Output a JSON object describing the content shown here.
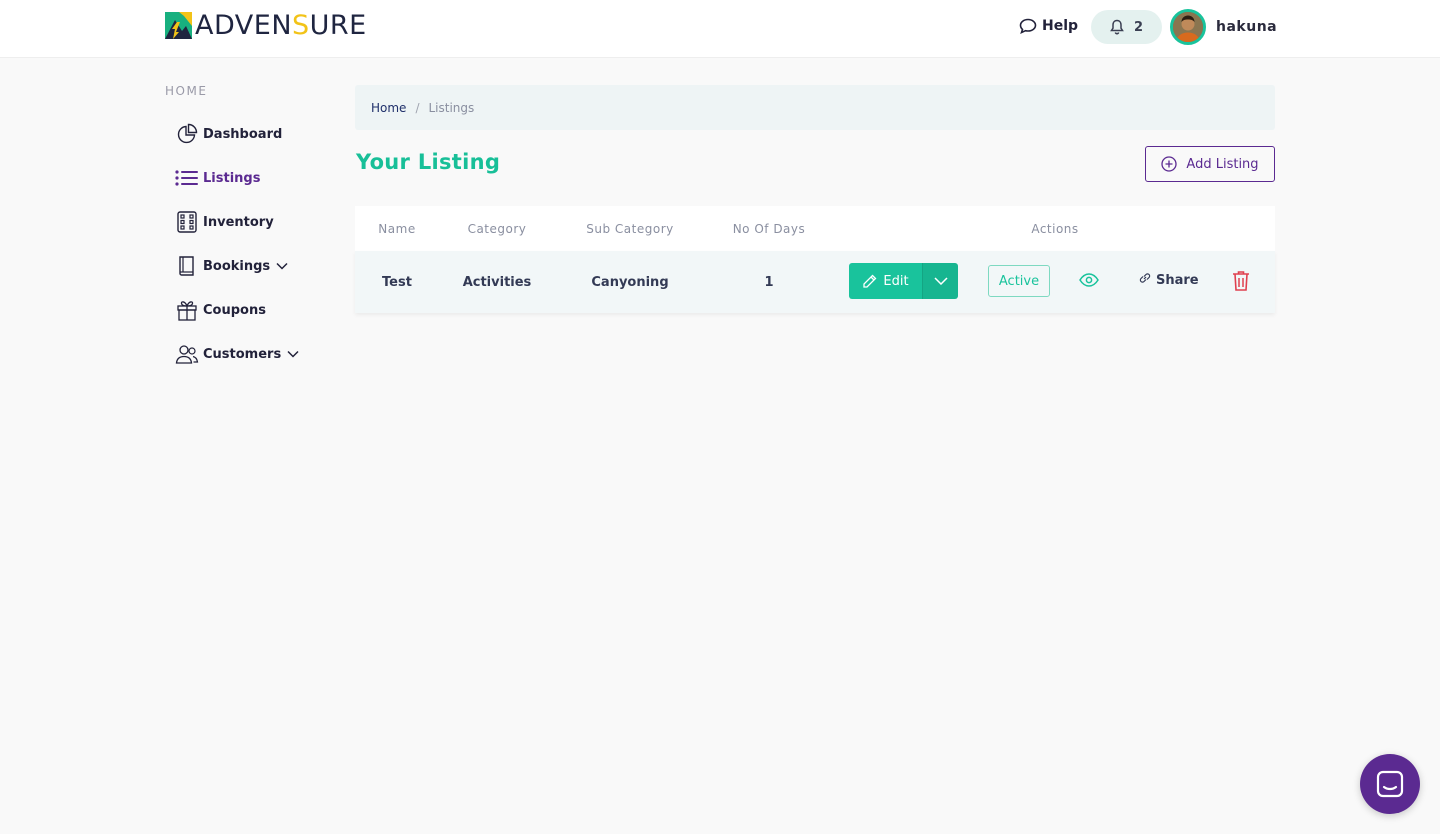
{
  "brand": {
    "name_part1": "ADVEN",
    "name_highlight": "S",
    "name_part2": "URE",
    "logo_icon": "mountain-logo-icon",
    "colors": {
      "primary": "#19c39c",
      "accent": "#5b2a91",
      "highlight": "#f2c318"
    }
  },
  "header": {
    "help_label": "Help",
    "help_icon": "chat-bubble-icon",
    "notification_icon": "bell-icon",
    "notification_count": "2",
    "username": "hakuna"
  },
  "sidebar": {
    "heading": "HOME",
    "items": [
      {
        "label": "Dashboard",
        "icon": "pie-chart-icon",
        "active": false
      },
      {
        "label": "Listings",
        "icon": "list-icon",
        "active": true
      },
      {
        "label": "Inventory",
        "icon": "inventory-icon",
        "active": false
      },
      {
        "label": "Bookings",
        "icon": "book-icon",
        "active": false,
        "expandable": true
      },
      {
        "label": "Coupons",
        "icon": "gift-icon",
        "active": false
      },
      {
        "label": "Customers",
        "icon": "users-icon",
        "active": false,
        "expandable": true
      }
    ]
  },
  "breadcrumb": {
    "home": "Home",
    "separator": "/",
    "current": "Listings"
  },
  "page": {
    "title": "Your Listing",
    "add_button": "Add Listing"
  },
  "table": {
    "headers": {
      "name": "Name",
      "category": "Category",
      "sub_category": "Sub Category",
      "days": "No Of Days",
      "actions": "Actions"
    },
    "rows": [
      {
        "name": "Test",
        "category": "Activities",
        "sub_category": "Canyoning",
        "days": "1",
        "edit": "Edit",
        "status": "Active",
        "share": "Share"
      }
    ]
  },
  "chat_widget": {
    "icon": "chat-launcher-icon"
  }
}
